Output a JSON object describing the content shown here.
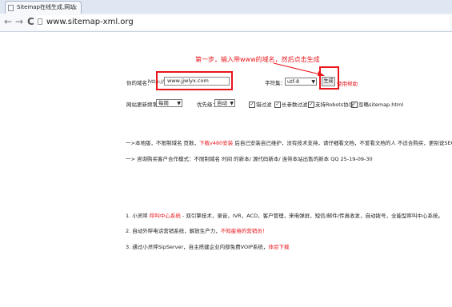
{
  "browser": {
    "tab_title": "Sitemap在线生成,网站",
    "tab_close": "×",
    "back": "←",
    "forward": "→",
    "reload": "C",
    "url": "www.sitemap-xml.org"
  },
  "annotation": {
    "text": "第一步，输入带www的域名，然后点击生成",
    "color": "#e8151b"
  },
  "form": {
    "domain_label": "你的域名：",
    "http_prefix": "http://",
    "domain_value": "www.jjwlyx.com",
    "charset_label": "字符集：",
    "charset_value": "utf-8",
    "generate_button": "生成",
    "help_link": "使用帮助",
    "freq_label": "网站更新频率：",
    "freq_value": "每周",
    "priority_label": "优先级：",
    "priority_value": "自动",
    "options": [
      {
        "label": "错过滤",
        "checked": true
      },
      {
        "label": "长参数过滤",
        "checked": true
      },
      {
        "label": "支持Robots协议",
        "checked": true
      },
      {
        "label": "忽略sitemap.html",
        "checked": true
      }
    ]
  },
  "notices": {
    "line1_prefix": "一>本地版，不限制域名 页数，",
    "line1_link": "下载v480安装",
    "line1_rest": " 后自己安装自己维护，没有技术支持，请仔细看文档，不爱看文档的人 不适合购买，更别说SEO！！！",
    "line2": "一> 咨询购买客户合作模式：不限制域名 时间 的新本/ 源代码新本/ 连带本站出售的新本 QQ 25-19-09-30"
  },
  "promo": [
    {
      "prefix": "1. 小灵呼 ",
      "link": "呼叫中心系统",
      "rest": " - 双引擎技术，录音，IVR，ACD，客户管理，来电弹屏，短信/邮件/传真收发，自动拨号，全能型呼叫中心系统。"
    },
    {
      "prefix": "2. 自动外呼电话营销系统，解放生产力，",
      "link": "不知疲倦的营销员！",
      "rest": ""
    },
    {
      "prefix": "3. 通过小灵呼SipServer，自主搭建企业内部免费VOIP系统，",
      "link": "体验下载",
      "rest": ""
    }
  ]
}
